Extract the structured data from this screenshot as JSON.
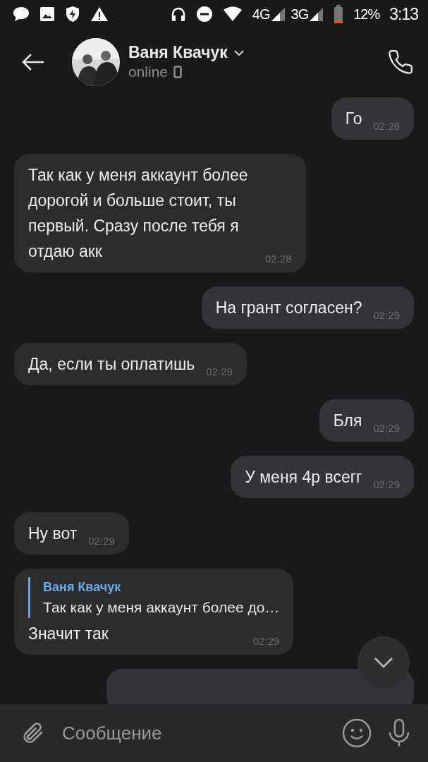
{
  "status_bar": {
    "network_labels": [
      "4G",
      "3G"
    ],
    "battery": "12%",
    "time": "3:13"
  },
  "header": {
    "name": "Ваня Квачук",
    "status": "online"
  },
  "messages": [
    {
      "outgoing": true,
      "partial": false,
      "text": "Го",
      "time": "02:28"
    },
    {
      "outgoing": false,
      "partial": false,
      "text": "Так как у меня аккаунт более дорогой и больше стоит, ты первый. Сразу после тебя я отдаю акк",
      "time": "02:28"
    },
    {
      "outgoing": true,
      "partial": false,
      "text": "На грант согласен?",
      "time": "02:29"
    },
    {
      "outgoing": false,
      "partial": false,
      "text": "Да, если ты оплатишь",
      "time": "02:29"
    },
    {
      "outgoing": true,
      "partial": false,
      "text": "Бля",
      "time": "02:29"
    },
    {
      "outgoing": true,
      "partial": false,
      "text": "У меня 4р всегг",
      "time": "02:29"
    },
    {
      "outgoing": false,
      "partial": false,
      "text": "Ну вот",
      "time": "02:29"
    },
    {
      "outgoing": false,
      "partial": false,
      "text": "Значит так",
      "time": "02:29",
      "reply": {
        "author": "Ваня Квачук",
        "text": "Так как у меня аккаунт более до…"
      }
    },
    {
      "outgoing": true,
      "partial": true
    }
  ],
  "composer": {
    "placeholder": "Сообщение"
  }
}
